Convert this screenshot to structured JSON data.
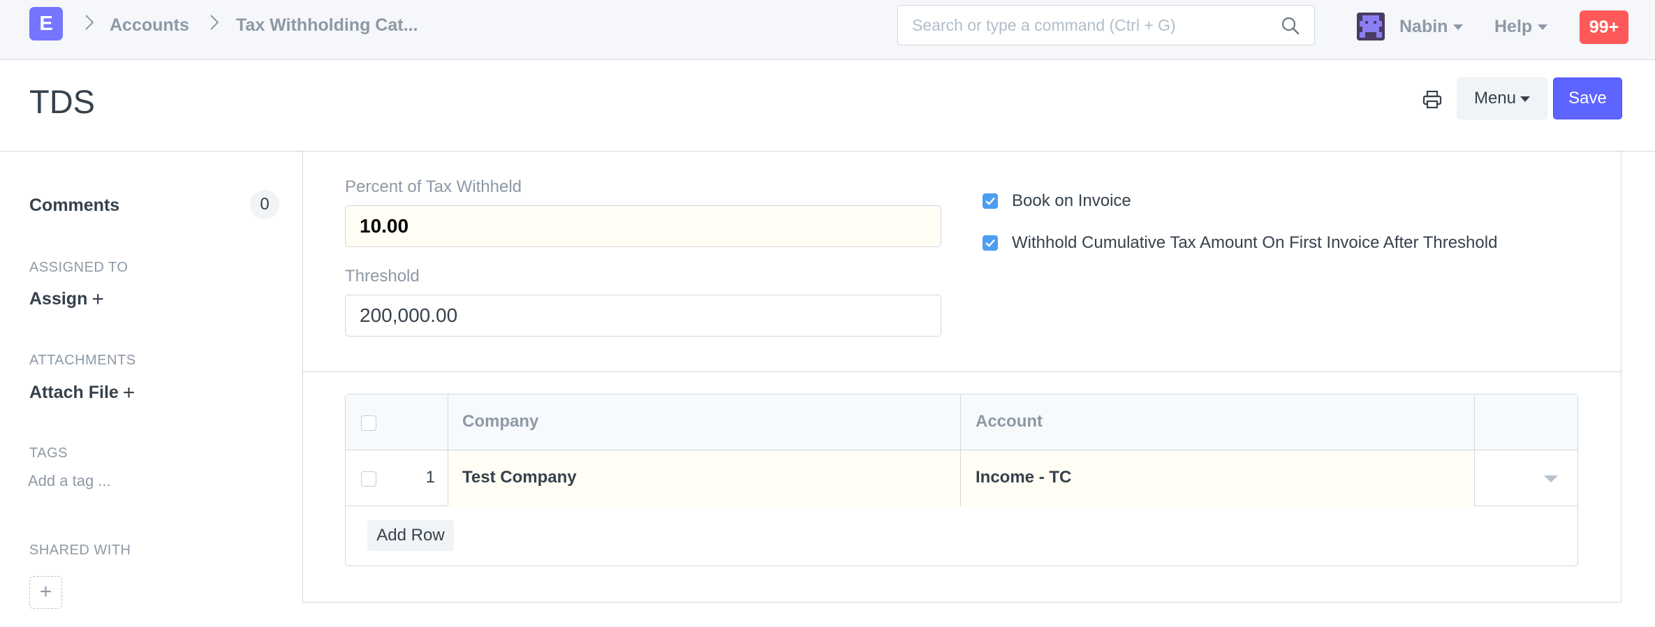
{
  "navbar": {
    "logo_letter": "E",
    "breadcrumbs": [
      "Accounts",
      "Tax Withholding Cat..."
    ],
    "search_placeholder": "Search or type a command (Ctrl + G)",
    "user_name": "Nabin",
    "help_label": "Help",
    "notifications": "99+"
  },
  "page_head": {
    "title": "TDS",
    "menu_label": "Menu",
    "save_label": "Save"
  },
  "sidebar": {
    "comments_label": "Comments",
    "comments_count": "0",
    "assigned_to_label": "ASSIGNED TO",
    "assign_label": "Assign",
    "attachments_label": "ATTACHMENTS",
    "attach_file_label": "Attach File",
    "tags_label": "TAGS",
    "add_tag_label": "Add a tag ...",
    "shared_with_label": "SHARED WITH"
  },
  "form": {
    "percent_label": "Percent of Tax Withheld",
    "percent_value": "10.00",
    "threshold_label": "Threshold",
    "threshold_value": "200,000.00",
    "book_on_invoice_label": "Book on Invoice",
    "book_on_invoice_checked": true,
    "withhold_cumulative_label": "Withhold Cumulative Tax Amount On First Invoice After Threshold",
    "withhold_cumulative_checked": true
  },
  "grid": {
    "columns": [
      "Company",
      "Account"
    ],
    "rows": [
      {
        "idx": "1",
        "company": "Test Company",
        "account": "Income - TC"
      }
    ],
    "add_row_label": "Add Row"
  },
  "colors": {
    "primary": "#5e64ff",
    "logo": "#7575ff",
    "notification": "#ff5858",
    "checkbox": "#4c9ef0"
  },
  "icons": {
    "search": "search-icon",
    "print": "print-icon",
    "avatar": "avatar-icon"
  }
}
